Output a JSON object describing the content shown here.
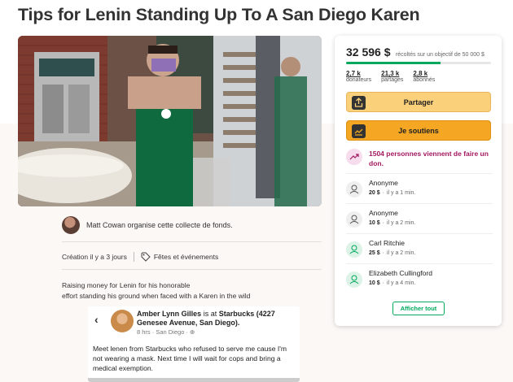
{
  "page": {
    "title": "Tips for Lenin Standing Up To A San Diego Karen"
  },
  "organizer": {
    "text": "Matt Cowan organise cette collecte de fonds."
  },
  "meta": {
    "created": "Création il y a 3 jours",
    "category": "Fêtes et événements"
  },
  "description": {
    "line1": "Raising money for Lenin for his honorable",
    "line2": "effort standing his ground when faced with a Karen in the wild"
  },
  "fb_post": {
    "author": "Amber Lynn Gilles",
    "is_at": "is at",
    "place": "Starbucks (4227 Genesee Avenue, San Diego).",
    "when": "8 hrs · San Diego · ",
    "body": "Meet lenen from Starbucks who refused to serve me cause I'm not wearing a mask. Next time I will wait for cops and bring a medical exemption.",
    "back_icon": "back-arrow-icon"
  },
  "sidebar": {
    "raised": "32 596 $",
    "goal_text": "récoltés sur un objectif de 50 000 $",
    "progress": 0.65,
    "stats": [
      {
        "value": "2,7 k",
        "label": "donateurs"
      },
      {
        "value": "21,3 k",
        "label": "partages"
      },
      {
        "value": "2,8 k",
        "label": "abonnés"
      }
    ],
    "share_label": "Partager",
    "donate_label": "Je soutiens",
    "trend_text": "1504 personnes viennent de faire un don.",
    "donors": [
      {
        "name": "Anonyme",
        "amount": "20 $",
        "time": "il y a 1 min.",
        "icon": "grey"
      },
      {
        "name": "Anonyme",
        "amount": "10 $",
        "time": "il y a 2 min.",
        "icon": "grey"
      },
      {
        "name": "Carl Ritchie",
        "amount": "25 $",
        "time": "il y a 2 min.",
        "icon": "green"
      },
      {
        "name": "Elizabeth Cullingford",
        "amount": "10 $",
        "time": "il y a 4 min.",
        "icon": "green"
      }
    ],
    "show_all_label": "Afficher tout"
  },
  "colors": {
    "accent_green": "#02a95c",
    "share_button": "#fbd07b",
    "donate_button": "#f5a623",
    "trend_text": "#a2185f"
  }
}
